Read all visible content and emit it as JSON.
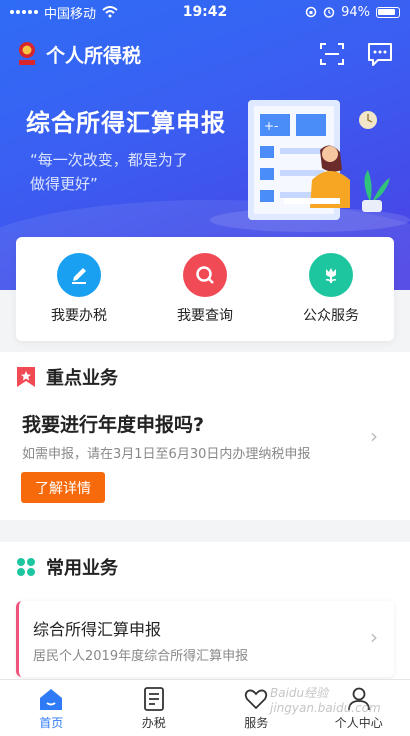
{
  "status_bar": {
    "carrier": "中国移动",
    "time": "19:42",
    "battery": "94%"
  },
  "header": {
    "title": "个人所得税"
  },
  "hero": {
    "title": "综合所得汇算申报",
    "quote_line1": "“每一次改变，都是为了",
    "quote_line2": "做得更好”"
  },
  "quick_actions": [
    {
      "label": "我要办税",
      "icon": "pen-icon",
      "color": "#1aa0f0"
    },
    {
      "label": "我要查询",
      "icon": "search-icon",
      "color": "#f04a55"
    },
    {
      "label": "公众服务",
      "icon": "flower-icon",
      "color": "#1ec6a0"
    }
  ],
  "key_business": {
    "title": "重点业务",
    "question": "我要进行年度申报吗?",
    "description": "如需申报，请在3月1日至6月30日内办理纳税申报",
    "button": "了解详情"
  },
  "common_business": {
    "title": "常用业务",
    "card_title": "综合所得汇算申报",
    "card_desc": "居民个人2019年度综合所得汇算申报"
  },
  "tabs": [
    {
      "label": "首页",
      "icon": "home-icon",
      "active": true
    },
    {
      "label": "办税",
      "icon": "document-icon",
      "active": false
    },
    {
      "label": "服务",
      "icon": "heart-hands-icon",
      "active": false
    },
    {
      "label": "个人中心",
      "icon": "person-icon",
      "active": false
    }
  ],
  "watermark": "Baidu经验 jingyan.baidu.com",
  "colors": {
    "primary": "#2f6cf5",
    "accent_orange": "#f76a0b",
    "tab_active": "#2f7bf5"
  }
}
